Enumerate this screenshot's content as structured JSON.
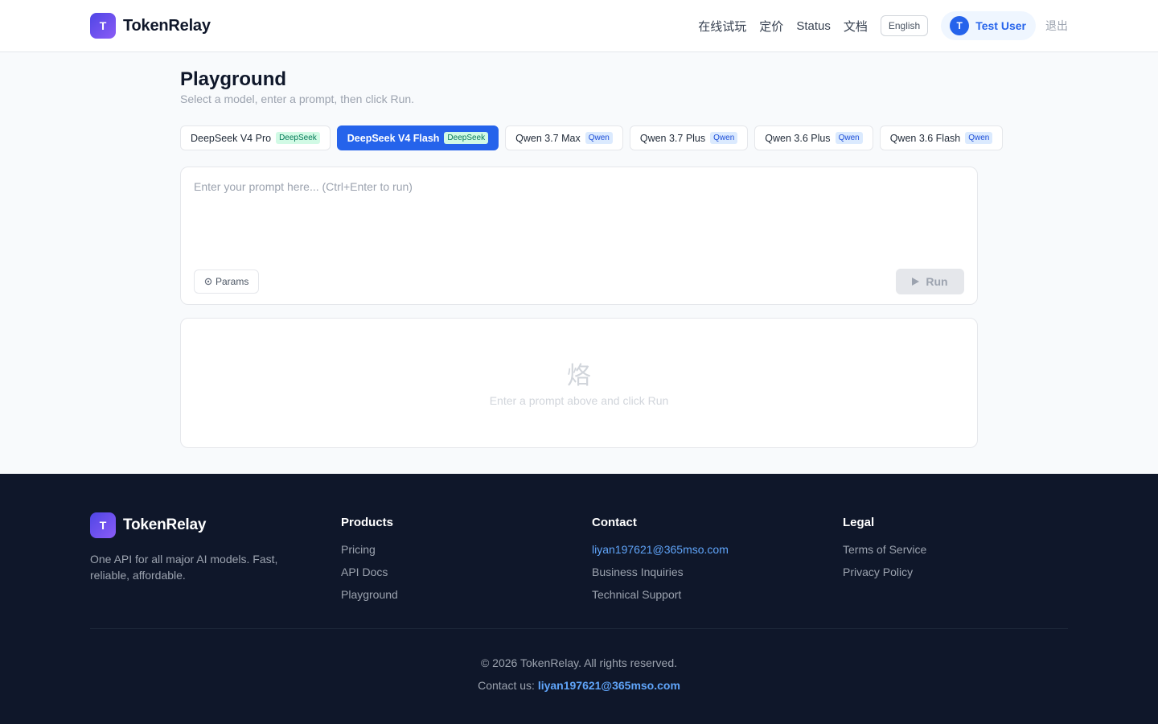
{
  "header": {
    "logo_letter": "T",
    "brand": "TokenRelay",
    "nav": [
      "在线试玩",
      "定价",
      "Status",
      "文档"
    ],
    "language": "English",
    "user": {
      "initial": "T",
      "name": "Test User"
    },
    "logout": "退出"
  },
  "main": {
    "title": "Playground",
    "subtitle": "Select a model, enter a prompt, then click Run.",
    "models": [
      {
        "name": "DeepSeek V4 Pro",
        "provider": "DeepSeek",
        "active": false
      },
      {
        "name": "DeepSeek V4 Flash",
        "provider": "DeepSeek",
        "active": true
      },
      {
        "name": "Qwen 3.7 Max",
        "provider": "Qwen",
        "active": false
      },
      {
        "name": "Qwen 3.7 Plus",
        "provider": "Qwen",
        "active": false
      },
      {
        "name": "Qwen 3.6 Plus",
        "provider": "Qwen",
        "active": false
      },
      {
        "name": "Qwen 3.6 Flash",
        "provider": "Qwen",
        "active": false
      }
    ],
    "prompt": {
      "value": "",
      "placeholder": "Enter your prompt here... (Ctrl+Enter to run)"
    },
    "params_label": "Params",
    "params_icon": "gear-icon",
    "run_label": "Run",
    "run_icon": "play-icon",
    "empty": {
      "glyph": "烙",
      "text": "Enter a prompt above and click Run"
    }
  },
  "footer": {
    "logo_letter": "T",
    "brand": "TokenRelay",
    "description": "One API for all major AI models. Fast, reliable, affordable.",
    "products": {
      "heading": "Products",
      "links": [
        "Pricing",
        "API Docs",
        "Playground"
      ]
    },
    "contact": {
      "heading": "Contact",
      "email": "liyan197621@365mso.com",
      "links": [
        "Business Inquiries",
        "Technical Support"
      ]
    },
    "legal": {
      "heading": "Legal",
      "links": [
        "Terms of Service",
        "Privacy Policy"
      ]
    },
    "copyright": "© 2026 TokenRelay. All rights reserved.",
    "contact_prefix": "Contact us:",
    "contact_email": "liyan197621@365mso.com"
  },
  "colors": {
    "primary": "#2563eb",
    "footer_bg": "#0f172a",
    "deepseek_badge_bg": "#d1fae5",
    "qwen_badge_bg": "#dbeafe"
  }
}
